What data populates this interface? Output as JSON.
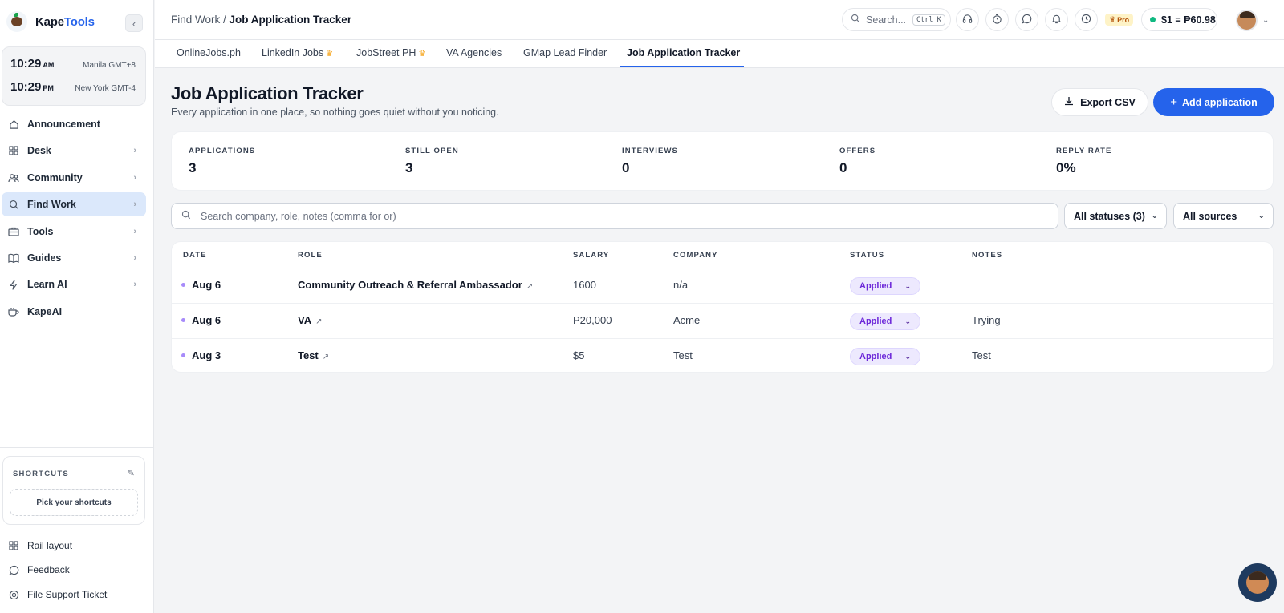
{
  "brand": {
    "name_part1": "Kape",
    "name_part2": "Tools"
  },
  "clocks": [
    {
      "time": "10:29",
      "ampm": "AM",
      "zone": "Manila GMT+8"
    },
    {
      "time": "10:29",
      "ampm": "PM",
      "zone": "New York GMT-4"
    }
  ],
  "sidebar": {
    "items": [
      {
        "label": "Announcement",
        "icon": "home-icon",
        "chevron": false
      },
      {
        "label": "Desk",
        "icon": "grid-icon",
        "chevron": true
      },
      {
        "label": "Community",
        "icon": "users-icon",
        "chevron": true
      },
      {
        "label": "Find Work",
        "icon": "search-icon",
        "chevron": true,
        "active": true
      },
      {
        "label": "Tools",
        "icon": "briefcase-icon",
        "chevron": true
      },
      {
        "label": "Guides",
        "icon": "book-icon",
        "chevron": true
      },
      {
        "label": "Learn AI",
        "icon": "bolt-icon",
        "chevron": true
      },
      {
        "label": "KapeAI",
        "icon": "coffee-icon",
        "chevron": false
      }
    ],
    "shortcuts": {
      "title": "SHORTCUTS",
      "pick_label": "Pick your shortcuts"
    },
    "footer": [
      {
        "label": "Rail layout",
        "icon": "grid-icon"
      },
      {
        "label": "Feedback",
        "icon": "chat-icon"
      },
      {
        "label": "File Support Ticket",
        "icon": "lifebuoy-icon"
      }
    ]
  },
  "topbar": {
    "breadcrumb_parent": "Find Work",
    "breadcrumb_sep": " / ",
    "breadcrumb_current": "Job Application Tracker",
    "search_placeholder": "Search...",
    "search_shortcut": "Ctrl K",
    "pro_label": "Pro",
    "rate_text": "$1 = ₱60.98"
  },
  "tabs": [
    {
      "label": "OnlineJobs.ph",
      "crown": false
    },
    {
      "label": "LinkedIn Jobs",
      "crown": true
    },
    {
      "label": "JobStreet PH",
      "crown": true
    },
    {
      "label": "VA Agencies",
      "crown": false
    },
    {
      "label": "GMap Lead Finder",
      "crown": false
    },
    {
      "label": "Job Application Tracker",
      "crown": false,
      "active": true
    }
  ],
  "page": {
    "title": "Job Application Tracker",
    "subtitle": "Every application in one place, so nothing goes quiet without you noticing.",
    "export_label": "Export CSV",
    "add_label": "Add application"
  },
  "stats": [
    {
      "label": "APPLICATIONS",
      "value": "3"
    },
    {
      "label": "STILL OPEN",
      "value": "3"
    },
    {
      "label": "INTERVIEWS",
      "value": "0"
    },
    {
      "label": "OFFERS",
      "value": "0"
    },
    {
      "label": "REPLY RATE",
      "value": "0%"
    }
  ],
  "filters": {
    "search_placeholder": "Search company, role, notes (comma for or)",
    "status_value": "All statuses (3)",
    "source_value": "All sources"
  },
  "table": {
    "headers": [
      "DATE",
      "ROLE",
      "SALARY",
      "COMPANY",
      "STATUS",
      "NOTES"
    ],
    "rows": [
      {
        "date": "Aug 6",
        "role": "Community Outreach & Referral Ambassador",
        "salary": "1600",
        "company": "n/a",
        "status": "Applied",
        "notes": ""
      },
      {
        "date": "Aug 6",
        "role": "VA",
        "salary": "P20,000",
        "company": "Acme",
        "status": "Applied",
        "notes": "Trying"
      },
      {
        "date": "Aug 3",
        "role": "Test",
        "salary": "$5",
        "company": "Test",
        "status": "Applied",
        "notes": "Test"
      }
    ]
  },
  "colors": {
    "accent": "#2563eb",
    "status_applied": "#6d28d9",
    "online_dot": "#10b981"
  }
}
